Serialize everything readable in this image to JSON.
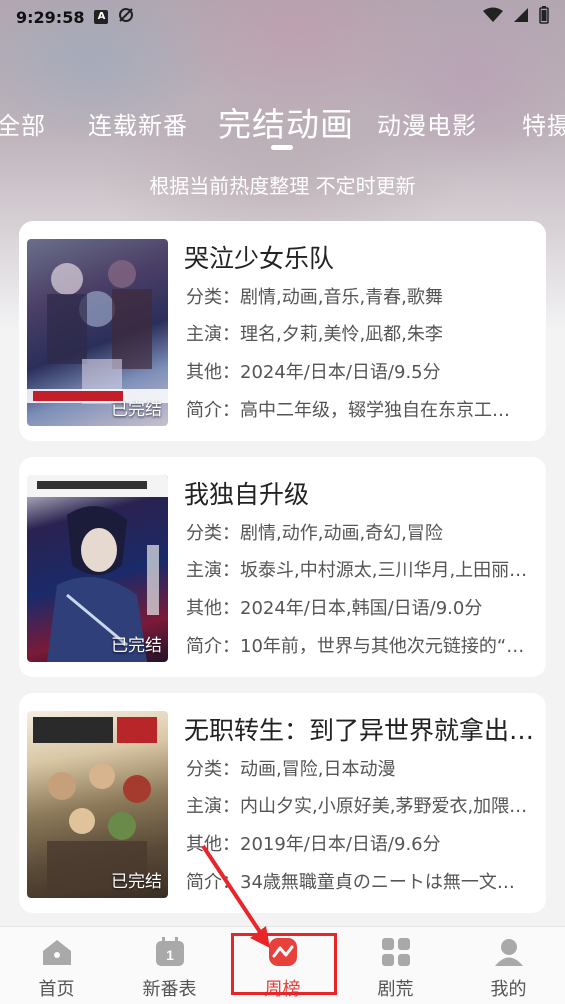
{
  "status_bar": {
    "time": "9:29:58",
    "icons": [
      "a-icon",
      "camera-off-icon"
    ]
  },
  "tabs": [
    {
      "label": "全部",
      "active": false
    },
    {
      "label": "连载新番",
      "active": false
    },
    {
      "label": "完结动画",
      "active": true
    },
    {
      "label": "动漫电影",
      "active": false
    },
    {
      "label": "特摄",
      "active": false
    }
  ],
  "subtitle": "根据当前热度整理 不定时更新",
  "items": [
    {
      "title": "哭泣少女乐队",
      "category": "分类：剧情,动画,音乐,青春,歌舞",
      "cast": "主演：理名,夕莉,美怜,凪都,朱李",
      "other": "其他：2024年/日本/日语/9.5分",
      "intro": "简介：高中二年级，辍学独自在东京工…",
      "status": "已完结"
    },
    {
      "title": "我独自升级",
      "category": "分类：剧情,动作,动画,奇幻,冒险",
      "cast": "主演：坂泰斗,中村源太,三川华月,上田丽…",
      "other": "其他：2024年/日本,韩国/日语/9.0分",
      "intro": "简介：10年前，世界与其他次元链接的“…",
      "status": "已完结"
    },
    {
      "title": "无职转生：到了异世界就拿出…",
      "category": "分类：动画,冒险,日本动漫",
      "cast": "主演：内山夕实,小原好美,茅野爱衣,加隈…",
      "other": "其他：2019年/日本/日语/9.6分",
      "intro": "简介：34歳無職童貞のニートは無一文…",
      "status": "已完结"
    }
  ],
  "bottom_nav": [
    {
      "label": "首页",
      "icon": "home-icon",
      "active": false
    },
    {
      "label": "新番表",
      "icon": "calendar-icon",
      "active": false,
      "badge": "1"
    },
    {
      "label": "周榜",
      "icon": "ranking-icon",
      "active": true
    },
    {
      "label": "剧荒",
      "icon": "grid-icon",
      "active": false
    },
    {
      "label": "我的",
      "icon": "profile-icon",
      "active": false
    }
  ],
  "colors": {
    "accent": "#e8413c",
    "annotation": "#e8262a"
  }
}
